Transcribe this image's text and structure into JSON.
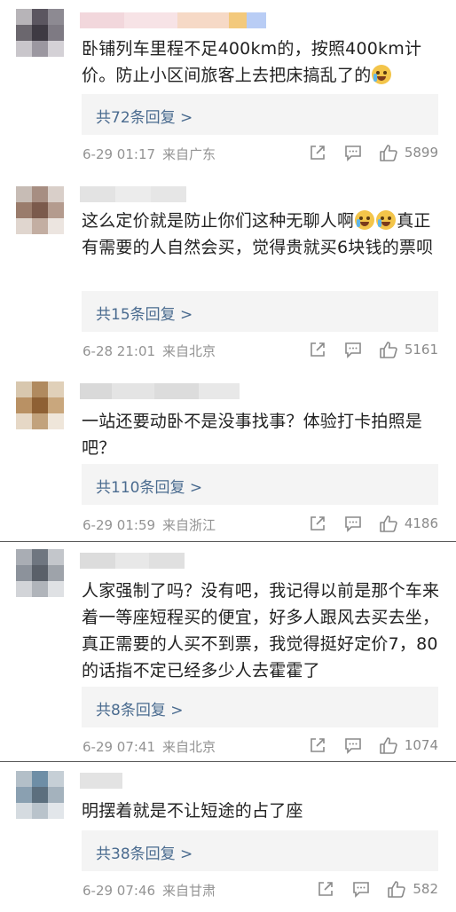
{
  "comments": [
    {
      "text_parts": [
        "卧铺列车里程不足400km的，按照400km计价。防止小区间旅客上去把床搞乱了的"
      ],
      "emoji": "laugh-cry-emoji",
      "reply_label": "共72条回复 >",
      "date": "6-29 01:17",
      "source": "来自广东",
      "likes": "5899"
    },
    {
      "text_parts": [
        "这么定价就是防止你们这种无聊人啊",
        "真正有需要的人自然会买，觉得贵就买6块钱的票呗"
      ],
      "reply_label": "共15条回复 >",
      "date": "6-28 21:01",
      "source": "来自北京",
      "likes": "5161"
    },
    {
      "text_parts": [
        "一站还要动卧不是没事找事？体验打卡拍照是吧？"
      ],
      "reply_label": "共110条回复 >",
      "date": "6-29 01:59",
      "source": "来自浙江",
      "likes": "4186"
    },
    {
      "text_parts": [
        "人家强制了吗？没有吧，我记得以前是那个车来着一等座短程买的便宜，好多人跟风去买去坐，真正需要的人买不到票，我觉得挺好定价7，80的话指不定已经多少人去霍霍了"
      ],
      "reply_label": "共8条回复 >",
      "date": "6-29 07:41",
      "source": "来自北京",
      "likes": "1074"
    },
    {
      "text_parts": [
        "明摆着就是不让短途的占了座"
      ],
      "reply_label": "共38条回复 >",
      "date": "6-29 07:46",
      "source": "来自甘肃",
      "likes": "582"
    }
  ],
  "icons": {
    "share": "share-icon",
    "comment": "comment-icon",
    "like": "thumbs-up-icon"
  },
  "colors": {
    "reply_link": "#4a6b8f",
    "meta": "#939393",
    "reply_bg": "#f4f4f4"
  }
}
